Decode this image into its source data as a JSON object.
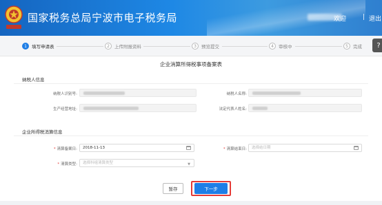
{
  "header": {
    "title": "国家税务总局宁波市电子税务局",
    "user_label": "欢迎",
    "separator": "|",
    "logout": "退出",
    "emblem_icon": "tax-emblem-icon"
  },
  "steps": [
    {
      "num": "1",
      "label": "填写申请表",
      "active": true
    },
    {
      "num": "2",
      "label": "上传附报资料",
      "active": false
    },
    {
      "num": "3",
      "label": "预览提交",
      "active": false
    },
    {
      "num": "4",
      "label": "审核中",
      "active": false
    },
    {
      "num": "5",
      "label": "完成",
      "active": false
    }
  ],
  "help_icon": "question-icon",
  "form": {
    "title": "企业消算所得税事项备案表",
    "taxpayer_section": "纳税人信息",
    "taxpayer_id_label": "纳税人识别号:",
    "taxpayer_name_label": "纳税人名称:",
    "address_label": "生产经营地址:",
    "legal_rep_label": "法定代表人姓名:",
    "liquidation_section": "企业所得税消算信息",
    "start_date_label": "清算备案日:",
    "start_date_value": "2018-11-13",
    "end_date_label": "清算结束日:",
    "end_date_placeholder": "选择结日期",
    "type_label": "清算类型:",
    "type_placeholder": "选择科组清算类型"
  },
  "buttons": {
    "save": "暂存",
    "next": "下一步"
  },
  "colors": {
    "header_blue": "#1e88e5",
    "accent_blue": "#1e7ee6",
    "highlight_red": "#e53935"
  }
}
